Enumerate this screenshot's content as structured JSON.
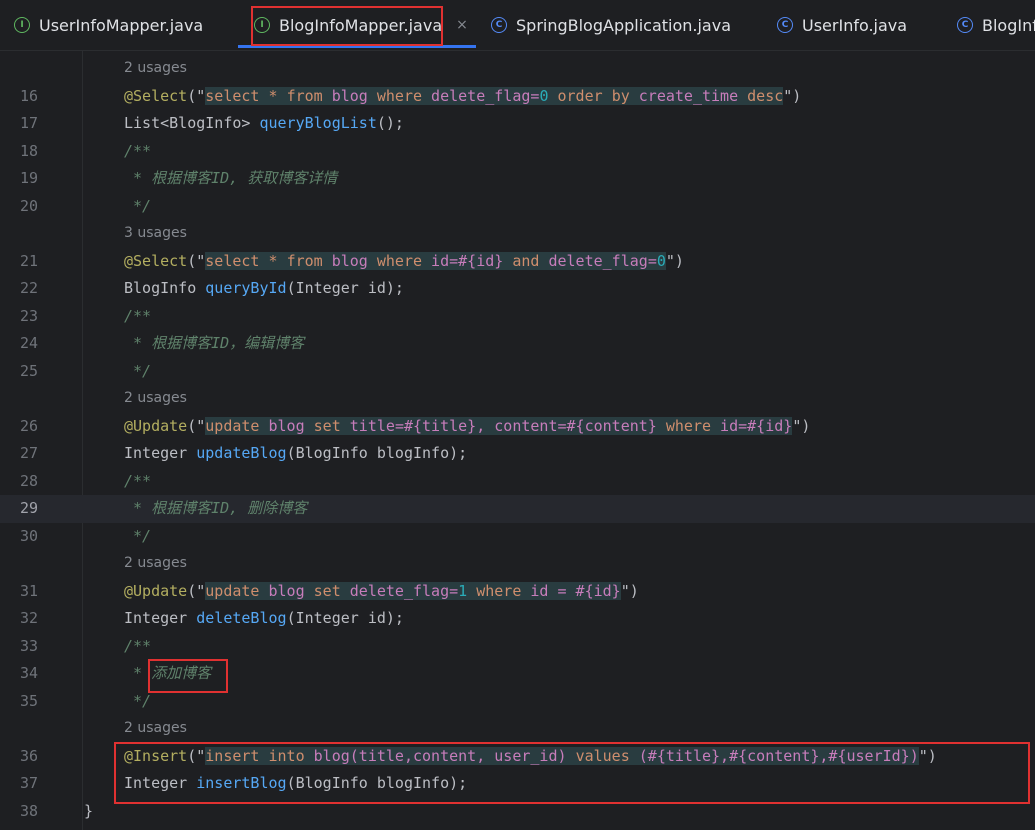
{
  "tabs": [
    {
      "label": "UserInfoMapper.java",
      "icon": "interface-icon"
    },
    {
      "label": "BlogInfoMapper.java",
      "icon": "interface-icon",
      "active": true,
      "close": "×"
    },
    {
      "label": "SpringBlogApplication.java",
      "icon": "class-run-icon"
    },
    {
      "label": "UserInfo.java",
      "icon": "class-icon"
    },
    {
      "label": "BlogInf",
      "icon": "class-icon"
    }
  ],
  "editor": {
    "usages": {
      "u1": "2 usages",
      "u2": "3 usages",
      "u3": "2 usages",
      "u4": "2 usages",
      "u5": "2 usages"
    },
    "lines": [
      {
        "n": "16",
        "t": [
          [
            "ann",
            "@Select"
          ],
          [
            "",
            "(\""
          ],
          [
            "sql",
            "select * from blog where delete_flag=0 order by create_time desc"
          ],
          [
            "",
            "\")"
          ]
        ]
      },
      {
        "n": "17",
        "t": [
          [
            "",
            "List<BlogInfo> "
          ],
          [
            "fn",
            "queryBlogList"
          ],
          [
            "",
            "();"
          ]
        ]
      },
      {
        "n": "18",
        "t": [
          [
            "jdoc",
            "/**"
          ]
        ]
      },
      {
        "n": "19",
        "t": [
          [
            "jdoc",
            " * 根据博客ID, 获取博客详情"
          ]
        ]
      },
      {
        "n": "20",
        "t": [
          [
            "jdoc",
            " */"
          ]
        ]
      },
      {
        "n": "21",
        "t": [
          [
            "ann",
            "@Select"
          ],
          [
            "",
            "(\""
          ],
          [
            "sql",
            "select * from blog where id=#{id} and delete_flag=0"
          ],
          [
            "",
            "\")"
          ]
        ]
      },
      {
        "n": "22",
        "t": [
          [
            "",
            "BlogInfo "
          ],
          [
            "fn",
            "queryById"
          ],
          [
            "",
            "(Integer id);"
          ]
        ]
      },
      {
        "n": "23",
        "t": [
          [
            "jdoc",
            "/**"
          ]
        ]
      },
      {
        "n": "24",
        "t": [
          [
            "jdoc",
            " * 根据博客ID，编辑博客"
          ]
        ]
      },
      {
        "n": "25",
        "t": [
          [
            "jdoc",
            " */"
          ]
        ]
      },
      {
        "n": "26",
        "t": [
          [
            "ann",
            "@Update"
          ],
          [
            "",
            "(\""
          ],
          [
            "sql",
            "update blog set title=#{title}, content=#{content} where id=#{id}"
          ],
          [
            "",
            "\")"
          ]
        ]
      },
      {
        "n": "27",
        "t": [
          [
            "",
            "Integer "
          ],
          [
            "fn",
            "updateBlog"
          ],
          [
            "",
            "(BlogInfo blogInfo);"
          ]
        ]
      },
      {
        "n": "28",
        "t": [
          [
            "jdoc",
            "/**"
          ]
        ]
      },
      {
        "n": "29",
        "t": [
          [
            "jdoc",
            " * 根据博客ID, 删除博客"
          ]
        ],
        "current": true
      },
      {
        "n": "30",
        "t": [
          [
            "jdoc",
            " */"
          ]
        ]
      },
      {
        "n": "31",
        "t": [
          [
            "ann",
            "@Update"
          ],
          [
            "",
            "(\""
          ],
          [
            "sql",
            "update blog set delete_flag=1 where id = #{id}"
          ],
          [
            "",
            "\")"
          ]
        ]
      },
      {
        "n": "32",
        "t": [
          [
            "",
            "Integer "
          ],
          [
            "fn",
            "deleteBlog"
          ],
          [
            "",
            "(Integer id);"
          ]
        ]
      },
      {
        "n": "33",
        "t": [
          [
            "jdoc",
            "/**"
          ]
        ]
      },
      {
        "n": "34",
        "t": [
          [
            "jdoc",
            " * 添加博客"
          ]
        ]
      },
      {
        "n": "35",
        "t": [
          [
            "jdoc",
            " */"
          ]
        ]
      },
      {
        "n": "36",
        "t": [
          [
            "ann",
            "@Insert"
          ],
          [
            "",
            "(\""
          ],
          [
            "sql",
            "insert into blog(title,content, user_id) values (#{title},#{content},#{userId})"
          ],
          [
            "",
            "\")"
          ]
        ]
      },
      {
        "n": "37",
        "t": [
          [
            "",
            "Integer "
          ],
          [
            "fn",
            "insertBlog"
          ],
          [
            "",
            "(BlogInfo blogInfo);"
          ]
        ]
      },
      {
        "n": "38",
        "t": [
          [
            "",
            "}"
          ]
        ]
      }
    ]
  },
  "colors": {
    "accent": "#3574f0",
    "highlight_box": "#e03131",
    "background": "#1e1f22"
  }
}
